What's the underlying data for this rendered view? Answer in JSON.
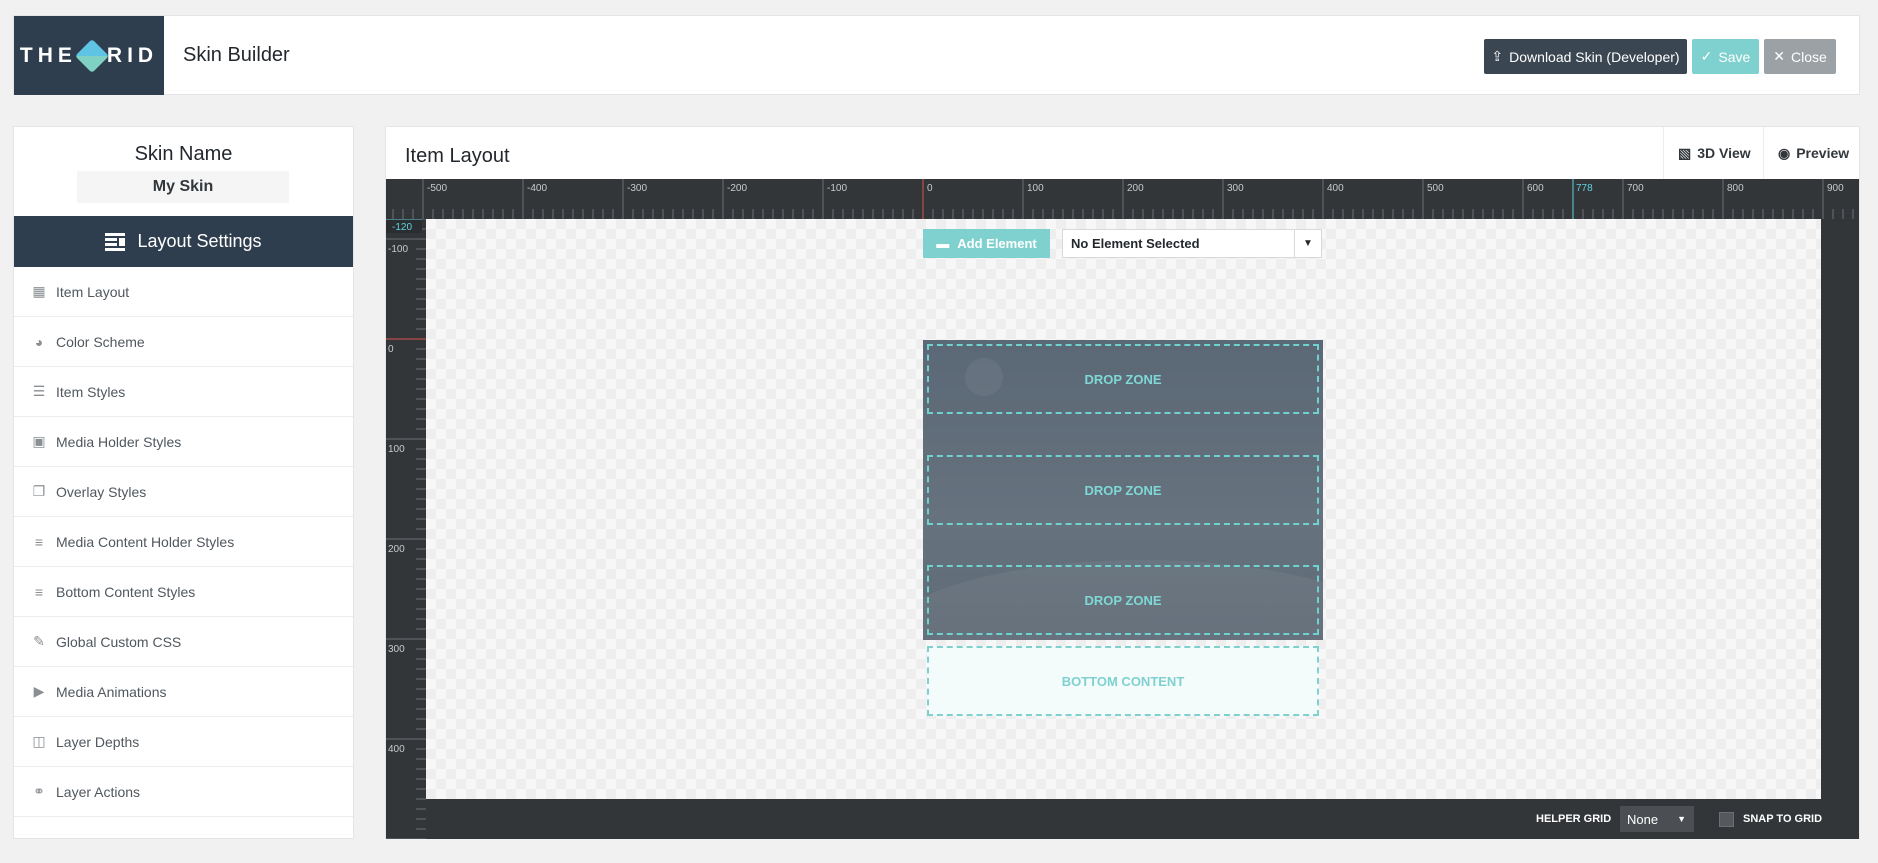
{
  "header": {
    "logo_left": "THE",
    "logo_right": "RID",
    "app_title": "Skin Builder",
    "download_label": "Download Skin (Developer)",
    "save_label": "Save",
    "close_label": "Close"
  },
  "sidebar": {
    "skin_name_label": "Skin Name",
    "skin_name_value": "My Skin",
    "section_title": "Layout Settings",
    "items": [
      {
        "label": "Item Layout",
        "icon": "grid-icon"
      },
      {
        "label": "Color Scheme",
        "icon": "palette-icon"
      },
      {
        "label": "Item Styles",
        "icon": "item-styles-icon"
      },
      {
        "label": "Media Holder Styles",
        "icon": "image-icon"
      },
      {
        "label": "Overlay Styles",
        "icon": "overlay-icon"
      },
      {
        "label": "Media Content Holder Styles",
        "icon": "lines-icon"
      },
      {
        "label": "Bottom Content Styles",
        "icon": "lines-icon"
      },
      {
        "label": "Global Custom CSS",
        "icon": "brush-icon"
      },
      {
        "label": "Media Animations",
        "icon": "video-icon"
      },
      {
        "label": "Layer Depths",
        "icon": "layers-icon"
      },
      {
        "label": "Layer Actions",
        "icon": "link-icon"
      }
    ]
  },
  "main": {
    "title": "Item Layout",
    "view_3d_label": "3D View",
    "preview_label": "Preview",
    "add_element_label": "Add Element",
    "element_select_value": "No Element Selected",
    "dropzones": [
      "DROP ZONE",
      "DROP ZONE",
      "DROP ZONE"
    ],
    "bottom_content_label": "BOTTOM CONTENT",
    "helper_grid_label": "HELPER GRID",
    "helper_grid_value": "None",
    "snap_label": "SNAP TO GRID",
    "ruler": {
      "h_labels": [
        "-500",
        "-400",
        "-300",
        "-200",
        "-100",
        "0",
        "100",
        "200",
        "300",
        "400",
        "500",
        "600",
        "700",
        "800",
        "900"
      ],
      "h_marker": "778",
      "v_labels": [
        "-100",
        "0",
        "100",
        "200",
        "300",
        "400"
      ],
      "v_marker": "-120"
    }
  },
  "colors": {
    "dark_navy": "#2f3e4e",
    "accent_teal": "#7fd1cf",
    "canvas_dark": "#333639",
    "ruler_marker_red": "#d9534f",
    "ruler_marker_teal": "#5fd3e0"
  }
}
